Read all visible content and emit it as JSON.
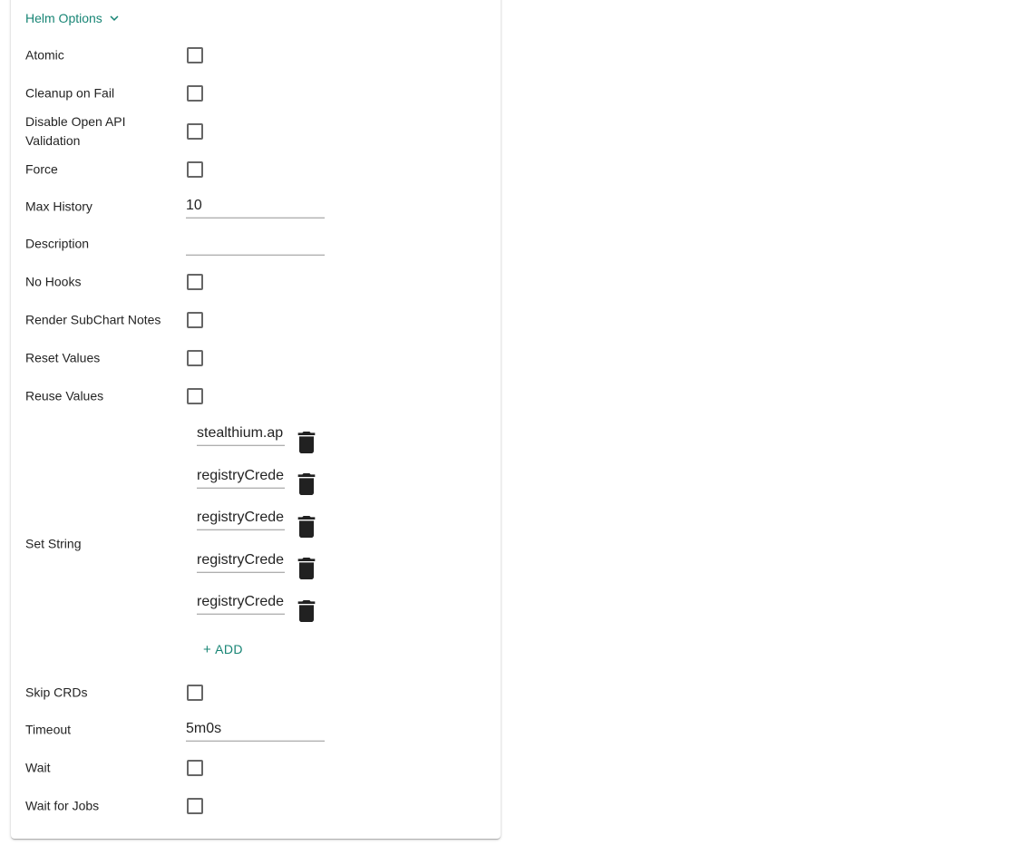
{
  "colors": {
    "accent": "#188575",
    "icon": "#212121"
  },
  "header": {
    "title": "Helm Options",
    "icon": "chevron-down-icon"
  },
  "rows": {
    "atomic": {
      "label": "Atomic",
      "checked": false
    },
    "cleanup_on_fail": {
      "label": "Cleanup on Fail",
      "checked": false
    },
    "disable_openapi": {
      "label": "Disable Open API Validation",
      "checked": false
    },
    "force": {
      "label": "Force",
      "checked": false
    },
    "max_history": {
      "label": "Max History",
      "value": "10"
    },
    "description": {
      "label": "Description",
      "value": ""
    },
    "no_hooks": {
      "label": "No Hooks",
      "checked": false
    },
    "render_subchart_notes": {
      "label": "Render SubChart Notes",
      "checked": false
    },
    "reset_values": {
      "label": "Reset Values",
      "checked": false
    },
    "reuse_values": {
      "label": "Reuse Values",
      "checked": false
    },
    "set_string": {
      "label": "Set String",
      "items": [
        "stealthium.ap",
        "registryCrede",
        "registryCrede",
        "registryCrede",
        "registryCrede"
      ],
      "delete_icon": "trash-icon",
      "add_label": "ADD",
      "add_icon": "plus-icon"
    },
    "skip_crds": {
      "label": "Skip CRDs",
      "checked": false
    },
    "timeout": {
      "label": "Timeout",
      "value": "5m0s"
    },
    "wait": {
      "label": "Wait",
      "checked": false
    },
    "wait_for_jobs": {
      "label": "Wait for Jobs",
      "checked": false
    }
  }
}
